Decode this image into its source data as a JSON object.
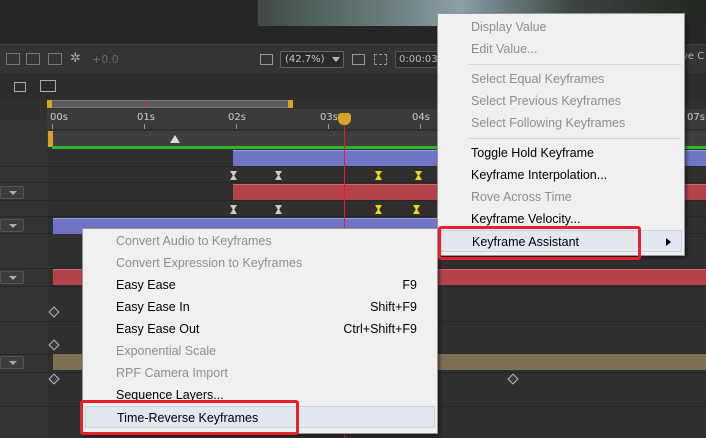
{
  "viewer": {
    "left_toolbar": {
      "offset_value": "+0.0"
    },
    "zoom": "(42.7%)",
    "timecode": "0:00:03",
    "right_cut_text": "ve C"
  },
  "timeline": {
    "ruler_labels": [
      "00s",
      "01s",
      "02s",
      "03s",
      "04s",
      "07s"
    ],
    "colors": {
      "current_time_indicator": "#e02020",
      "work_area_bar": "#2eb82e",
      "keyframe_selected": "#f4d41a"
    }
  },
  "context_menu_main": {
    "items": [
      {
        "label": "Display Value",
        "enabled": false
      },
      {
        "label": "Edit Value...",
        "enabled": false
      },
      {
        "label": "Select Equal Keyframes",
        "enabled": false
      },
      {
        "label": "Select Previous Keyframes",
        "enabled": false
      },
      {
        "label": "Select Following Keyframes",
        "enabled": false
      },
      {
        "label": "Toggle Hold Keyframe",
        "enabled": true
      },
      {
        "label": "Keyframe Interpolation...",
        "enabled": true
      },
      {
        "label": "Rove Across Time",
        "enabled": false
      },
      {
        "label": "Keyframe Velocity...",
        "enabled": true
      },
      {
        "label": "Keyframe Assistant",
        "enabled": true,
        "submenu": true,
        "highlighted": true
      }
    ]
  },
  "context_menu_sub": {
    "items": [
      {
        "label": "Convert Audio to Keyframes",
        "enabled": false,
        "shortcut": ""
      },
      {
        "label": "Convert Expression to Keyframes",
        "enabled": false,
        "shortcut": ""
      },
      {
        "label": "Easy Ease",
        "enabled": true,
        "shortcut": "F9"
      },
      {
        "label": "Easy Ease In",
        "enabled": true,
        "shortcut": "Shift+F9"
      },
      {
        "label": "Easy Ease Out",
        "enabled": true,
        "shortcut": "Ctrl+Shift+F9"
      },
      {
        "label": "Exponential Scale",
        "enabled": false,
        "shortcut": ""
      },
      {
        "label": "RPF Camera Import",
        "enabled": false,
        "shortcut": ""
      },
      {
        "label": "Sequence Layers...",
        "enabled": true,
        "shortcut": ""
      },
      {
        "label": "Time-Reverse Keyframes",
        "enabled": true,
        "shortcut": "",
        "highlighted": true
      }
    ]
  },
  "annotation_color": "#e8202b"
}
